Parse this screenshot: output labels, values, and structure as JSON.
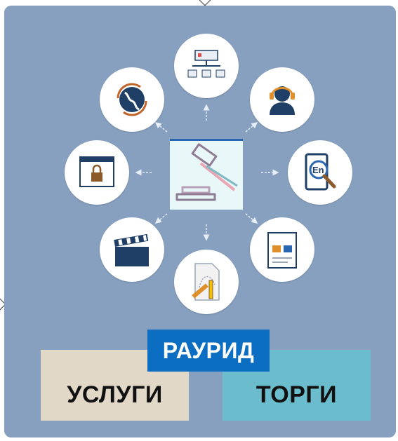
{
  "banner": {
    "brand_label": "РАУРИД",
    "services_label": "УСЛУГИ",
    "auctions_label": "ТОРГИ"
  },
  "icons": {
    "center": "gavel-icon",
    "top": "org-chart-icon",
    "top_right": "headset-user-icon",
    "right": "dictionary-search-icon",
    "bottom_right": "document-page-icon",
    "bottom": "drawing-pencil-icon",
    "bottom_left": "clapperboard-icon",
    "left": "secure-window-icon",
    "top_left": "globe-cycle-icon",
    "dictionary_letters": "En"
  },
  "colors": {
    "panel_bg": "#87a0bf",
    "brand_blue": "#0b6ec2",
    "services_beige": "#e2d8c8",
    "auctions_teal": "#6bbccd",
    "icon_navy": "#1f3f66"
  }
}
